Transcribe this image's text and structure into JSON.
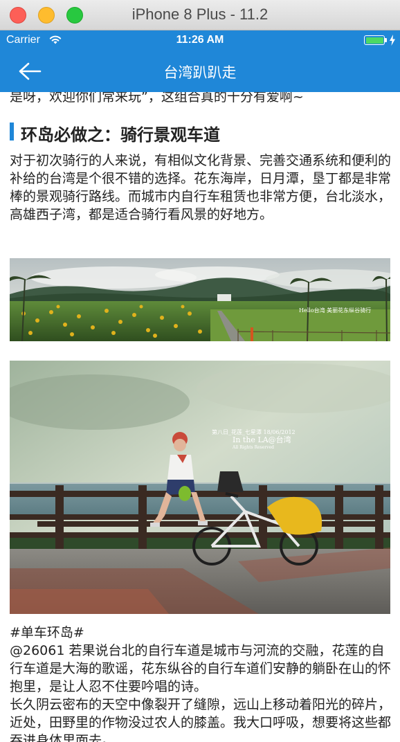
{
  "window": {
    "title": "iPhone 8 Plus - 11.2"
  },
  "status_bar": {
    "carrier": "Carrier",
    "time": "11:26 AM"
  },
  "nav": {
    "title": "台湾趴趴走"
  },
  "article": {
    "cut_line": "是呀，欢迎你们常来玩”，这组合真的十分有爱啊~",
    "section_heading": "环岛必做之：骑行景观车道",
    "paragraph1": "对于初次骑行的人来说，有相似文化背景、完善交通系统和便利的补给的台湾是个很不错的选择。花东海岸，日月潭，垦丁都是非常棒的景观骑行路线。而城市内自行车租赁也非常方便，台北淡水，高雄西子湾，都是适合骑行看风景的好地方。",
    "photo1_caption": "Hello台湾 美丽花东纵谷骑行",
    "photo2_caption_line1": "第八日_花莲_七星潭 18/06/2012",
    "photo2_caption_line2": "In the LA@台湾",
    "photo2_caption_line3": "All Rights Reserved",
    "tag": "#单车环岛#",
    "paragraph2": "@26061 若果说台北的自行车道是城市与河流的交融，花莲的自行车道是大海的歌谣，花东纵谷的自行车道们安静的躺卧在山的怀抱里，是让人忍不住要吟唱的诗。",
    "paragraph3": "长久阴云密布的天空中像裂开了缝隙，远山上移动着阳光的碎片，近处，田野里的作物没过农人的膝盖。我大口呼吸，想要将这些都吞进身体里面去。"
  },
  "colors": {
    "accent": "#1f87d8",
    "battery": "#4cd964"
  },
  "icons": {
    "back": "back-arrow-icon",
    "wifi": "wifi-icon",
    "battery": "battery-icon",
    "charging": "charging-bolt-icon"
  }
}
